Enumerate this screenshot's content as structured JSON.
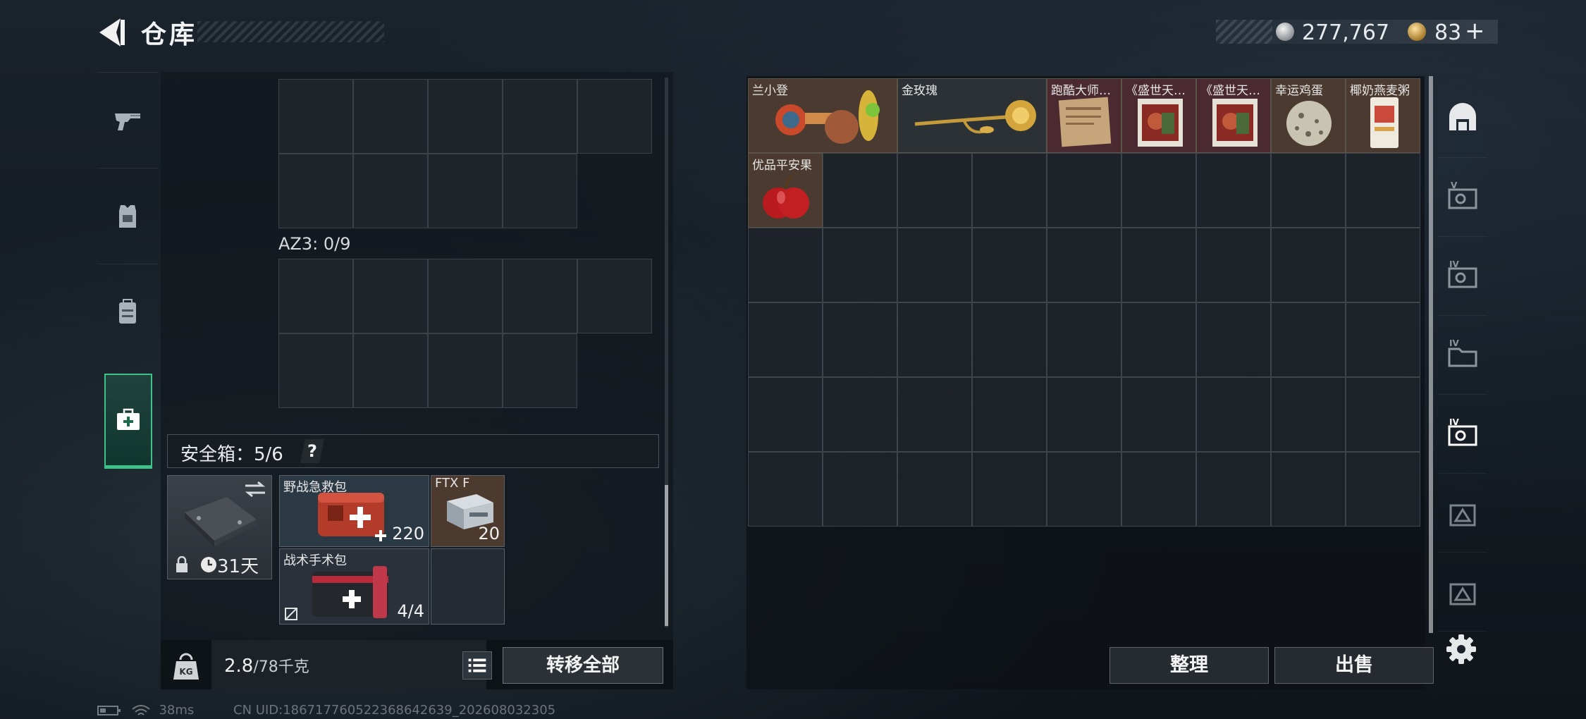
{
  "header": {
    "title": "仓库",
    "silver_amount": "277,767",
    "gold_amount": "83",
    "plus_label": "+"
  },
  "left_tabs": [
    {
      "name": "weapons",
      "icon": "pistol-icon"
    },
    {
      "name": "armor",
      "icon": "vest-icon"
    },
    {
      "name": "backpack",
      "icon": "backpack-icon"
    },
    {
      "name": "medical",
      "icon": "medkit-icon",
      "active": true
    }
  ],
  "container": {
    "az3_label": "AZ3: 0/9"
  },
  "safe_box": {
    "label": "安全箱：5/6",
    "help": "?",
    "days_left": "31天",
    "items": [
      {
        "name": "野战急救包",
        "count": "220"
      },
      {
        "name": "FTX F",
        "count": "20"
      },
      {
        "name": "战术手术包",
        "count": "4/4"
      }
    ]
  },
  "weight": {
    "current": "2.8",
    "max": "/78千克"
  },
  "buttons": {
    "transfer_all": "转移全部",
    "organize": "整理",
    "sell": "出售"
  },
  "stash_items": [
    {
      "name": "兰小登",
      "col": 0,
      "row": 0,
      "w": 2
    },
    {
      "name": "金玫瑰",
      "col": 2,
      "row": 0,
      "w": 2
    },
    {
      "name": "跑酷大师…",
      "col": 4,
      "row": 0,
      "w": 1
    },
    {
      "name": "《盛世天…",
      "col": 5,
      "row": 0,
      "w": 1
    },
    {
      "name": "《盛世天…",
      "col": 6,
      "row": 0,
      "w": 1
    },
    {
      "name": "幸运鸡蛋",
      "col": 7,
      "row": 0,
      "w": 1
    },
    {
      "name": "椰奶燕麦粥",
      "col": 8,
      "row": 0,
      "w": 1
    },
    {
      "name": "优品平安果",
      "col": 0,
      "row": 1,
      "w": 1
    }
  ],
  "right_tabs": [
    {
      "name": "home",
      "icon": "shelter-icon"
    },
    {
      "name": "tier-5-safe",
      "icon": "safe-v-icon"
    },
    {
      "name": "tier-4-safe",
      "icon": "safe-iv-icon"
    },
    {
      "name": "tier-4-folder",
      "icon": "folder-iv-icon"
    },
    {
      "name": "tier-4-safe-2",
      "icon": "safe-iv-active-icon",
      "active": true
    },
    {
      "name": "tier-3-frame",
      "icon": "frame-iii-icon"
    },
    {
      "name": "tier-3-frame-2",
      "icon": "frame-iii-b-icon"
    }
  ],
  "status": {
    "ping": "38ms",
    "uid": "CN UID:186717760522368642639_202608032305"
  },
  "colors": {
    "accent_green": "#3ec28a",
    "panel_bg": "#1f252b",
    "grid_line": "#3d444b"
  }
}
